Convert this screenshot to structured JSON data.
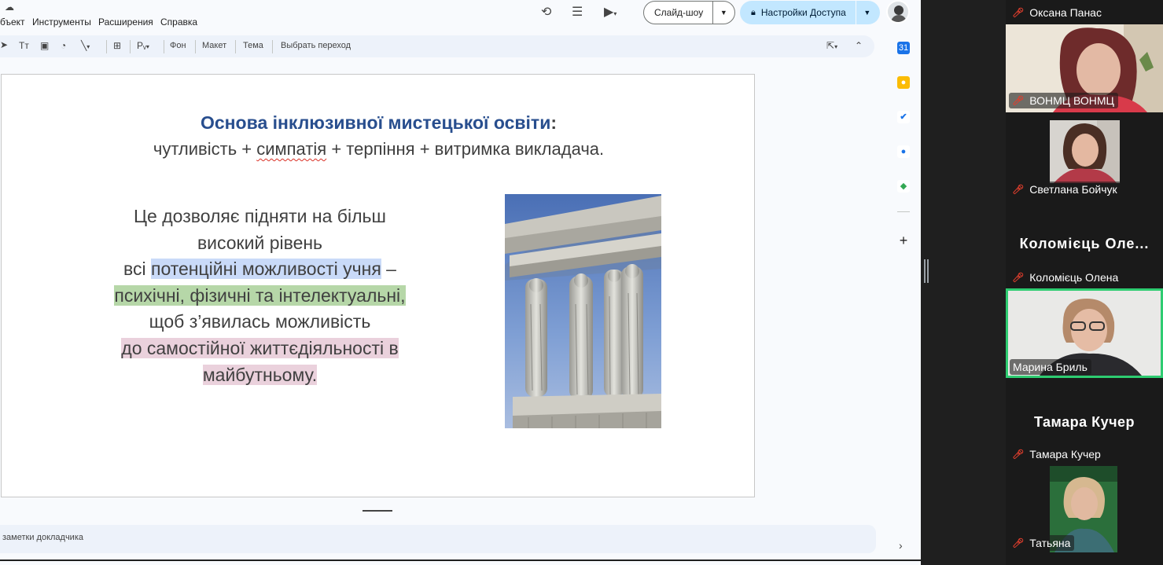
{
  "menubar": {
    "items": [
      "бъект",
      "Инструменты",
      "Расширения",
      "Справка"
    ],
    "slideshow_label": "Слайд-шоу",
    "access_label": "Настройки Доступа"
  },
  "formatbar": {
    "background_label": "Фон",
    "layout_label": "Макет",
    "theme_label": "Тема",
    "transition_label": "Выбрать переход"
  },
  "slide": {
    "title": "Основа інклюзивної мистецької освіти",
    "title_suffix": ":",
    "subtitle_pre": "чутливість + ",
    "subtitle_mis": "симпатія",
    "subtitle_post": " + терпіння + витримка викладача.",
    "body": {
      "line1": "Це дозволяє підняти на більш",
      "line2": "високий рівень",
      "line3_pre": "всі ",
      "line3_hl": "потенційні можливості учня",
      "line3_post": " –",
      "line4": "психічні, фізичні та інтелектуальні,",
      "line5": "щоб з’явилась можливість",
      "line6": "до самостійної життєдіяльності в",
      "line7": "майбутньому."
    }
  },
  "notes": {
    "label": "заметки докладчика"
  },
  "participants": [
    {
      "name": "Оксана Панас",
      "muted": true
    },
    {
      "name": "ВОНМЦ ВОНМЦ",
      "muted": true
    },
    {
      "name": "Светлана Бойчук",
      "muted": true
    },
    {
      "name": "Коломієць Олена",
      "display": "Коломієць  Оле...",
      "muted": true
    },
    {
      "name": "Марина Бриль",
      "muted": false,
      "active_speaker": true
    },
    {
      "name": "Тамара Кучер",
      "display": "Тамара Кучер",
      "muted": true
    },
    {
      "name": "Татьяна",
      "muted": true
    }
  ],
  "colors": {
    "title": "#284e8e",
    "highlight_blue": "#c9daf8",
    "highlight_green": "#b6d7a8",
    "highlight_pink": "#ead1dc",
    "active_speaker_border": "#2ecc71",
    "muted_mic": "#e03e2d"
  }
}
